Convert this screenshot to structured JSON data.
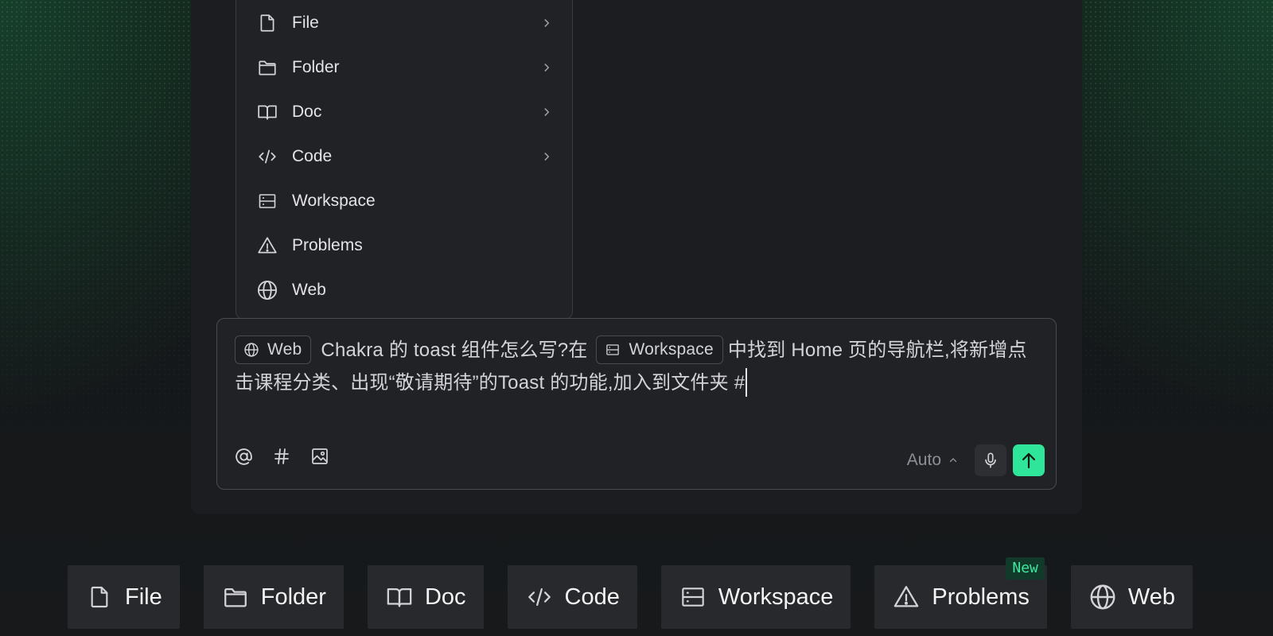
{
  "menu": {
    "items": [
      {
        "label": "File",
        "icon": "file-icon",
        "has_submenu": true
      },
      {
        "label": "Folder",
        "icon": "folder-icon",
        "has_submenu": true
      },
      {
        "label": "Doc",
        "icon": "book-icon",
        "has_submenu": true
      },
      {
        "label": "Code",
        "icon": "code-icon",
        "has_submenu": true
      },
      {
        "label": "Workspace",
        "icon": "workspace-icon",
        "has_submenu": false
      },
      {
        "label": "Problems",
        "icon": "warning-icon",
        "has_submenu": false
      },
      {
        "label": "Web",
        "icon": "globe-icon",
        "has_submenu": false
      }
    ]
  },
  "composer": {
    "chip_web": "Web",
    "text_1": "Chakra 的 toast 组件怎么写?在",
    "chip_workspace": "Workspace",
    "text_2": "中找到 Home 页的导航栏,将新增点击课程分类、出现“敬请期待”的Toast 的功能,加入到文件夹 #",
    "tools": [
      "at-icon",
      "hash-icon",
      "image-icon"
    ],
    "model": "Auto",
    "mic": "microphone-icon",
    "send": "arrow-up-icon",
    "accent": "#2ee59a"
  },
  "bottom_bar": {
    "items": [
      {
        "label": "File",
        "icon": "file-icon"
      },
      {
        "label": "Folder",
        "icon": "folder-icon"
      },
      {
        "label": "Doc",
        "icon": "book-icon"
      },
      {
        "label": "Code",
        "icon": "code-icon"
      },
      {
        "label": "Workspace",
        "icon": "workspace-icon"
      },
      {
        "label": "Problems",
        "icon": "warning-icon",
        "badge": "New"
      },
      {
        "label": "Web",
        "icon": "globe-icon"
      }
    ]
  }
}
